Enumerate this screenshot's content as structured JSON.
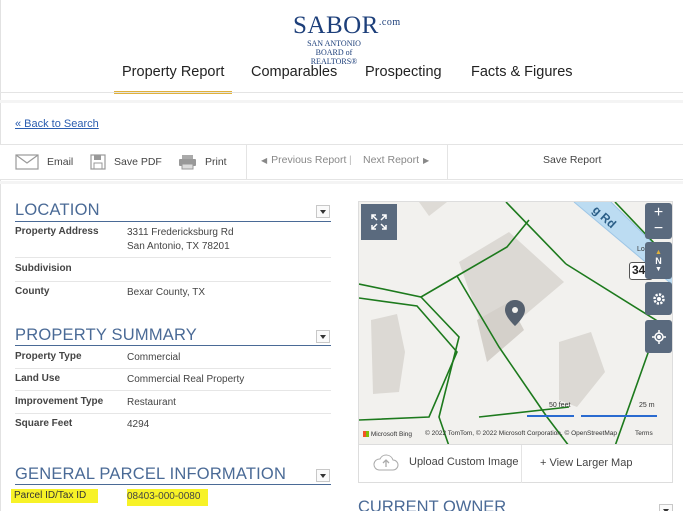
{
  "logo": {
    "main": "SABOR",
    "suffix": ".com",
    "sub1": "SAN ANTONIO",
    "sub2": "BOARD of REALTORS®"
  },
  "nav": {
    "items": [
      "Property Report",
      "Comparables",
      "Prospecting",
      "Facts & Figures"
    ],
    "active": "Property Report"
  },
  "back_link": "« Back to Search",
  "toolbar": {
    "email": "Email",
    "save_pdf": "Save PDF",
    "print": "Print",
    "previous": "Previous Report",
    "next": "Next Report",
    "save_report": "Save Report"
  },
  "location": {
    "title": "LOCATION",
    "rows": [
      {
        "label": "Property Address",
        "value_line1": "3311 Fredericksburg Rd",
        "value_line2": "San Antonio, TX 78201"
      },
      {
        "label": "Subdivision",
        "value": ""
      },
      {
        "label": "County",
        "value": "Bexar County, TX"
      }
    ]
  },
  "summary": {
    "title": "PROPERTY SUMMARY",
    "rows": [
      {
        "label": "Property Type",
        "value": "Commercial"
      },
      {
        "label": "Land Use",
        "value": "Commercial Real Property"
      },
      {
        "label": "Improvement Type",
        "value": "Restaurant"
      },
      {
        "label": "Square Feet",
        "value": "4294"
      }
    ]
  },
  "parcel": {
    "title": "GENERAL PARCEL INFORMATION",
    "rows": [
      {
        "label": "Parcel ID/Tax ID",
        "value": "08403-000-0080"
      }
    ]
  },
  "map": {
    "road_label": "g Rd",
    "road_number": "34",
    "scale_feet": "50 feet",
    "scale_m": "25 m",
    "attribution_brand": "Microsoft Bing",
    "attribution": "© 2022 TomTom, © 2022 Microsoft Corporation, © OpenStreetMap",
    "terms": "Terms",
    "upload_label": "Upload Custom Image",
    "larger_label": "+ View Larger Map",
    "compass": "N",
    "loc": "Loc"
  },
  "current_owner": "CURRENT OWNER",
  "colors": {
    "accent": "#e0b13a",
    "section": "#4a6a96",
    "highlight": "#f7f227",
    "parcel_line": "#1d7a1d"
  }
}
